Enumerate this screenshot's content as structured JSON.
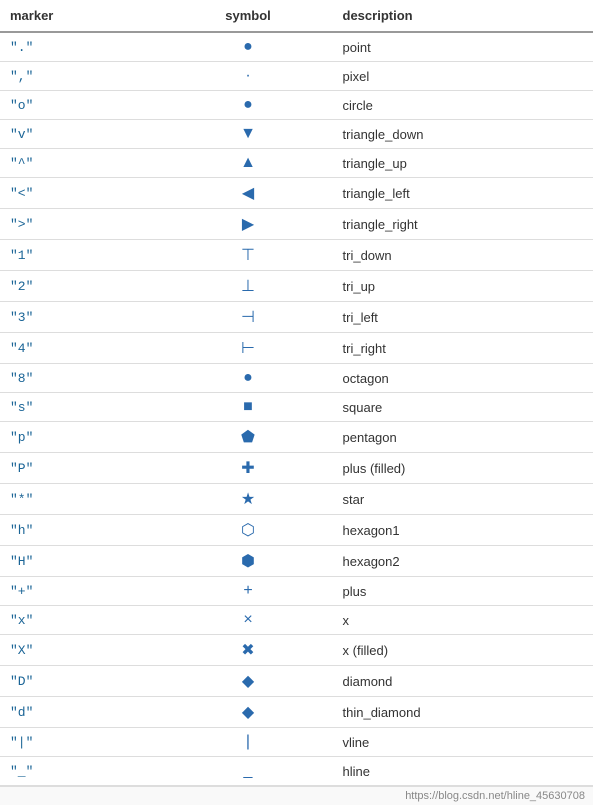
{
  "table": {
    "headers": [
      "marker",
      "symbol",
      "description"
    ],
    "rows": [
      {
        "marker": "\".\"",
        "symbol": "●",
        "symbol_class": "sym-blue s-point",
        "description": "point"
      },
      {
        "marker": "\",\"",
        "symbol": "·",
        "symbol_class": "sym-blue s-pixel",
        "description": "pixel"
      },
      {
        "marker": "\"o\"",
        "symbol": "●",
        "symbol_class": "sym-blue",
        "description": "circle"
      },
      {
        "marker": "\"v\"",
        "symbol": "▼",
        "symbol_class": "sym-blue",
        "description": "triangle_down"
      },
      {
        "marker": "\"^\"",
        "symbol": "▲",
        "symbol_class": "sym-blue",
        "description": "triangle_up"
      },
      {
        "marker": "\"<\"",
        "symbol": "◀",
        "symbol_class": "sym-blue",
        "description": "triangle_left"
      },
      {
        "marker": "\">\"",
        "symbol": "▶",
        "symbol_class": "sym-blue",
        "description": "triangle_right"
      },
      {
        "marker": "\"1\"",
        "symbol": "⊤",
        "symbol_class": "sym-blue",
        "description": "tri_down"
      },
      {
        "marker": "\"2\"",
        "symbol": "⊥",
        "symbol_class": "sym-blue",
        "description": "tri_up"
      },
      {
        "marker": "\"3\"",
        "symbol": "⊣",
        "symbol_class": "sym-blue",
        "description": "tri_left"
      },
      {
        "marker": "\"4\"",
        "symbol": "⊢",
        "symbol_class": "sym-blue",
        "description": "tri_right"
      },
      {
        "marker": "\"8\"",
        "symbol": "●",
        "symbol_class": "sym-blue",
        "description": "octagon"
      },
      {
        "marker": "\"s\"",
        "symbol": "■",
        "symbol_class": "sym-blue",
        "description": "square"
      },
      {
        "marker": "\"p\"",
        "symbol": "⬟",
        "symbol_class": "sym-blue",
        "description": "pentagon"
      },
      {
        "marker": "\"P\"",
        "symbol": "✚",
        "symbol_class": "sym-blue",
        "description": "plus (filled)"
      },
      {
        "marker": "\"*\"",
        "symbol": "★",
        "symbol_class": "sym-blue",
        "description": "star"
      },
      {
        "marker": "\"h\"",
        "symbol": "⬡",
        "symbol_class": "sym-blue",
        "description": "hexagon1"
      },
      {
        "marker": "\"H\"",
        "symbol": "⬢",
        "symbol_class": "sym-blue",
        "description": "hexagon2"
      },
      {
        "marker": "\"+\"",
        "symbol": "+",
        "symbol_class": "sym-blue",
        "description": "plus"
      },
      {
        "marker": "\"x\"",
        "symbol": "×",
        "symbol_class": "sym-blue",
        "description": "x"
      },
      {
        "marker": "\"X\"",
        "symbol": "✖",
        "symbol_class": "sym-blue",
        "description": "x (filled)"
      },
      {
        "marker": "\"D\"",
        "symbol": "◆",
        "symbol_class": "sym-blue",
        "description": "diamond"
      },
      {
        "marker": "\"d\"",
        "symbol": "◆",
        "symbol_class": "sym-blue",
        "description": "thin_diamond"
      },
      {
        "marker": "\"|\"",
        "symbol": "|",
        "symbol_class": "sym-blue",
        "description": "vline"
      },
      {
        "marker": "\"_\"",
        "symbol": "_",
        "symbol_class": "sym-blue",
        "description": "hline"
      }
    ],
    "watermark": "https://blog.csdn.net/hline_45630708"
  }
}
